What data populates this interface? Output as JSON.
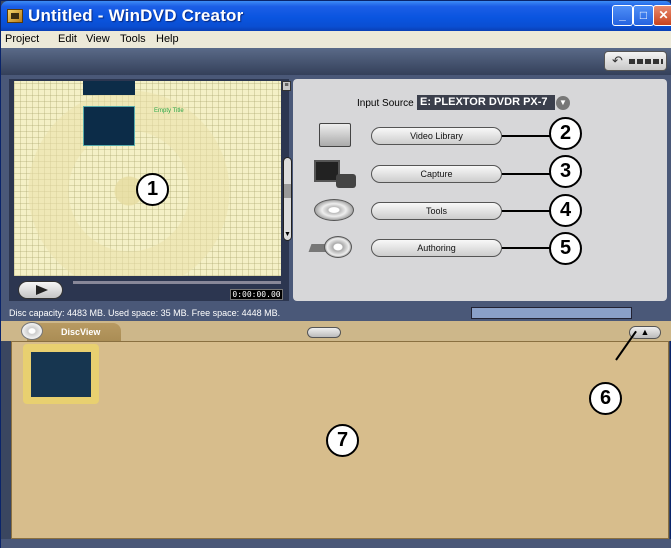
{
  "window": {
    "title": "Untitled - WinDVD Creator",
    "controls": {
      "minimize": "_",
      "maximize": "□",
      "close": "✕"
    }
  },
  "menubar": {
    "items": [
      "Project",
      "Edit",
      "View",
      "Tools",
      "Help"
    ]
  },
  "toolbar": {
    "undo_icon": "↶"
  },
  "preview": {
    "empty_title": "Empty Title",
    "timecode": "0:00:00.00",
    "side_button": "≡",
    "slider_down": "▼"
  },
  "input_source": {
    "label": "Input Source",
    "value": "E: PLEXTOR DVDR   PX-7",
    "arrow": "▼"
  },
  "actions": [
    {
      "label": "Video Library",
      "icon": "folder-icon"
    },
    {
      "label": "Capture",
      "icon": "capture-icon"
    },
    {
      "label": "Tools",
      "icon": "disc-icon"
    },
    {
      "label": "Authoring",
      "icon": "authoring-icon"
    }
  ],
  "status": {
    "text": "Disc capacity: 4483 MB. Used space: 35 MB. Free space: 4448 MB.",
    "used_fraction": 0.0078
  },
  "discview": {
    "tab_label": "DiscView",
    "eject": "▲"
  },
  "callouts": [
    "1",
    "2",
    "3",
    "4",
    "5",
    "6",
    "7"
  ]
}
